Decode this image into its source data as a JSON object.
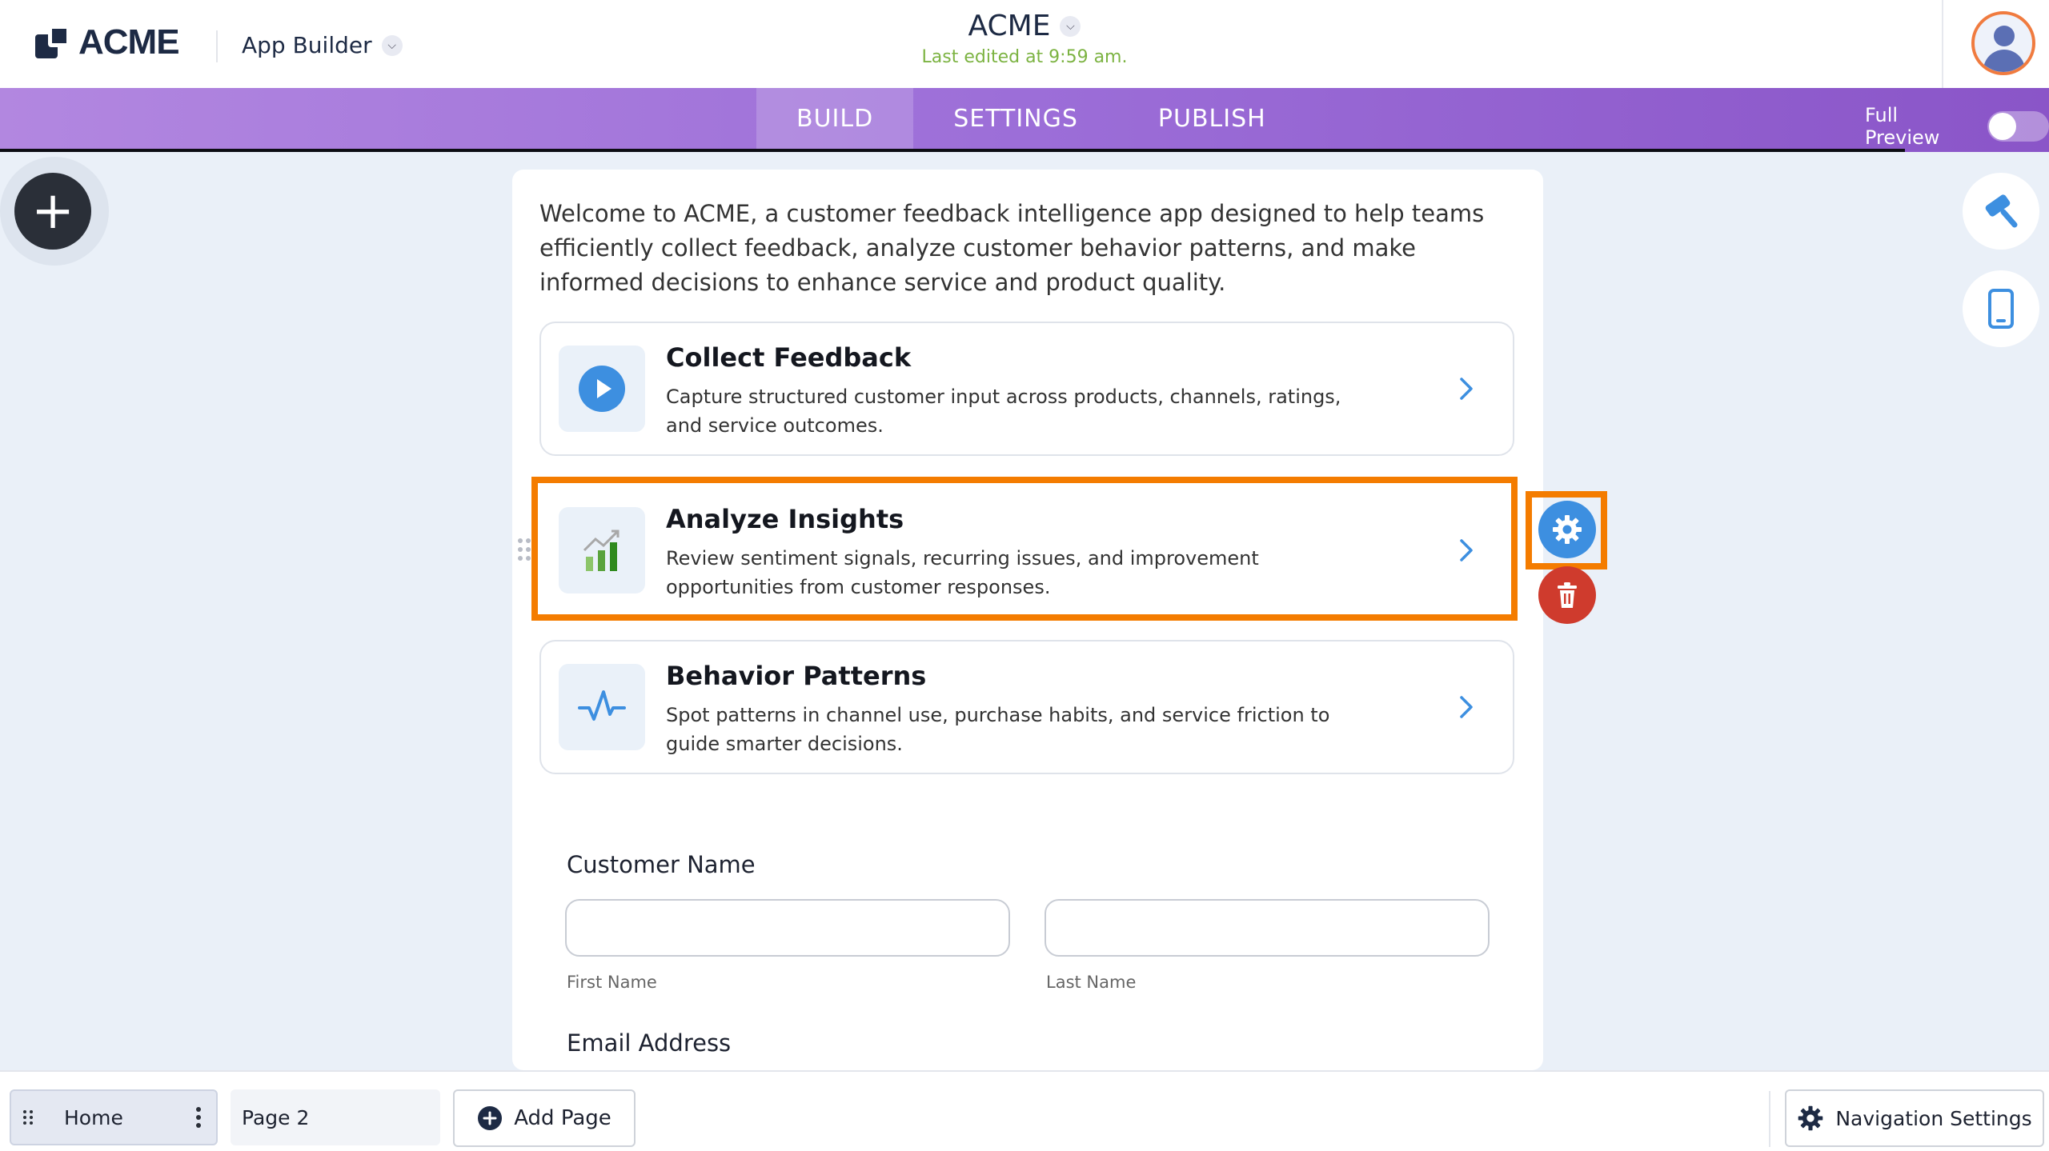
{
  "header": {
    "logo_text": "ACME",
    "app_builder_label": "App Builder",
    "app_title": "ACME",
    "last_edited": "Last edited at 9:59 am."
  },
  "navbar": {
    "tabs": [
      {
        "label": "BUILD",
        "active": true
      },
      {
        "label": "SETTINGS",
        "active": false
      },
      {
        "label": "PUBLISH",
        "active": false
      }
    ],
    "full_preview_label": "Full Preview",
    "full_preview_on": false
  },
  "canvas": {
    "intro": "Welcome to ACME, a customer feedback intelligence app designed to help teams efficiently collect feedback, analyze customer behavior patterns, and make informed decisions to enhance service and product quality.",
    "cards": [
      {
        "title": "Collect Feedback",
        "description": "Capture structured customer input across products, channels, ratings, and service outcomes.",
        "icon": "play-circle-icon"
      },
      {
        "title": "Analyze Insights",
        "description": "Review sentiment signals, recurring issues, and improvement opportunities from customer responses.",
        "icon": "bar-chart-trend-icon",
        "selected": true
      },
      {
        "title": "Behavior Patterns",
        "description": "Spot patterns in channel use, purchase habits, and service friction to guide smarter decisions.",
        "icon": "pulse-line-icon"
      }
    ],
    "form": {
      "customer_name_label": "Customer Name",
      "first_name_label": "First Name",
      "last_name_label": "Last Name",
      "email_label": "Email Address"
    }
  },
  "footer": {
    "pages": [
      {
        "label": "Home",
        "active": true
      },
      {
        "label": "Page 2",
        "active": false
      }
    ],
    "add_page_label": "Add Page",
    "nav_settings_label": "Navigation Settings"
  },
  "colors": {
    "accent_purple": "#9c6ed8",
    "highlight_orange": "#f47c00",
    "gear_blue": "#3d8fe0",
    "trash_red": "#cf3b2d",
    "last_edited_green": "#7cb342"
  }
}
